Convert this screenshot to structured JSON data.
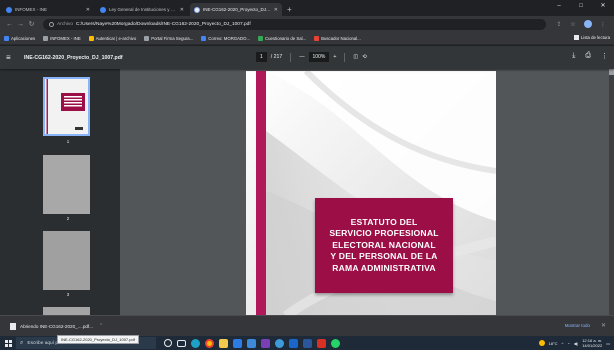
{
  "tabs": [
    {
      "title": "INFOMEX - INE",
      "active": false
    },
    {
      "title": "Ley General de Instituciones y Pr...",
      "active": false
    },
    {
      "title": "INE-CG162-2020_Proyecto_DJ_100...",
      "active": true
    }
  ],
  "window_controls": {
    "minimize": "–",
    "maximize": "□",
    "close": "✕"
  },
  "omnibox": {
    "protocol": "Archivo",
    "url": "C:/Users/Naye%20Morgado/Downloads/INE-CG162-2020_Proyecto_DJ_1007.pdf"
  },
  "bookmarks": [
    {
      "label": "Aplicaciones",
      "color": "#4285f4"
    },
    {
      "label": "INFOMEX - INE",
      "color": "#9aa0a6"
    },
    {
      "label": "Autenticar | e-archivo",
      "color": "#fbbc04"
    },
    {
      "label": "Portal Firma Segura...",
      "color": "#9aa0a6"
    },
    {
      "label": "Correo: MORGADO...",
      "color": "#4285f4"
    },
    {
      "label": "Cuestionario de Sal...",
      "color": "#34a853"
    },
    {
      "label": "Buscador Nacional...",
      "color": "#ea4335"
    }
  ],
  "bookmarks_right": "Lista de lectura",
  "pdf": {
    "filename": "INE-CG162-2020_Proyecto_DJ_1007.pdf",
    "page_current": "1",
    "page_total": "/ 217",
    "zoom": "100%",
    "zoom_minus": "—",
    "zoom_plus": "+"
  },
  "thumbnails": [
    {
      "num": "1",
      "selected": true
    },
    {
      "num": "2",
      "selected": false
    },
    {
      "num": "3",
      "selected": false
    }
  ],
  "document": {
    "cover_title": "ESTATUTO DEL\nSERVICIO PROFESIONAL\nELECTORAL NACIONAL\nY DEL PERSONAL DE LA\nRAMA ADMINISTRATIVA",
    "accent_color": "#9b0f46",
    "stripe_color": "#b0185a"
  },
  "download": {
    "item": "Abriendo INE-CG162-2020_....pdf...",
    "tooltip": "INE-CG162-2020_Proyecto_DJ_1007.pdf",
    "show_all": "Mostrar todo"
  },
  "taskbar": {
    "search_placeholder": "Escribe aquí para buscar",
    "weather": "18°C",
    "time": "12:16 a. m.",
    "date": "14/01/2022"
  }
}
